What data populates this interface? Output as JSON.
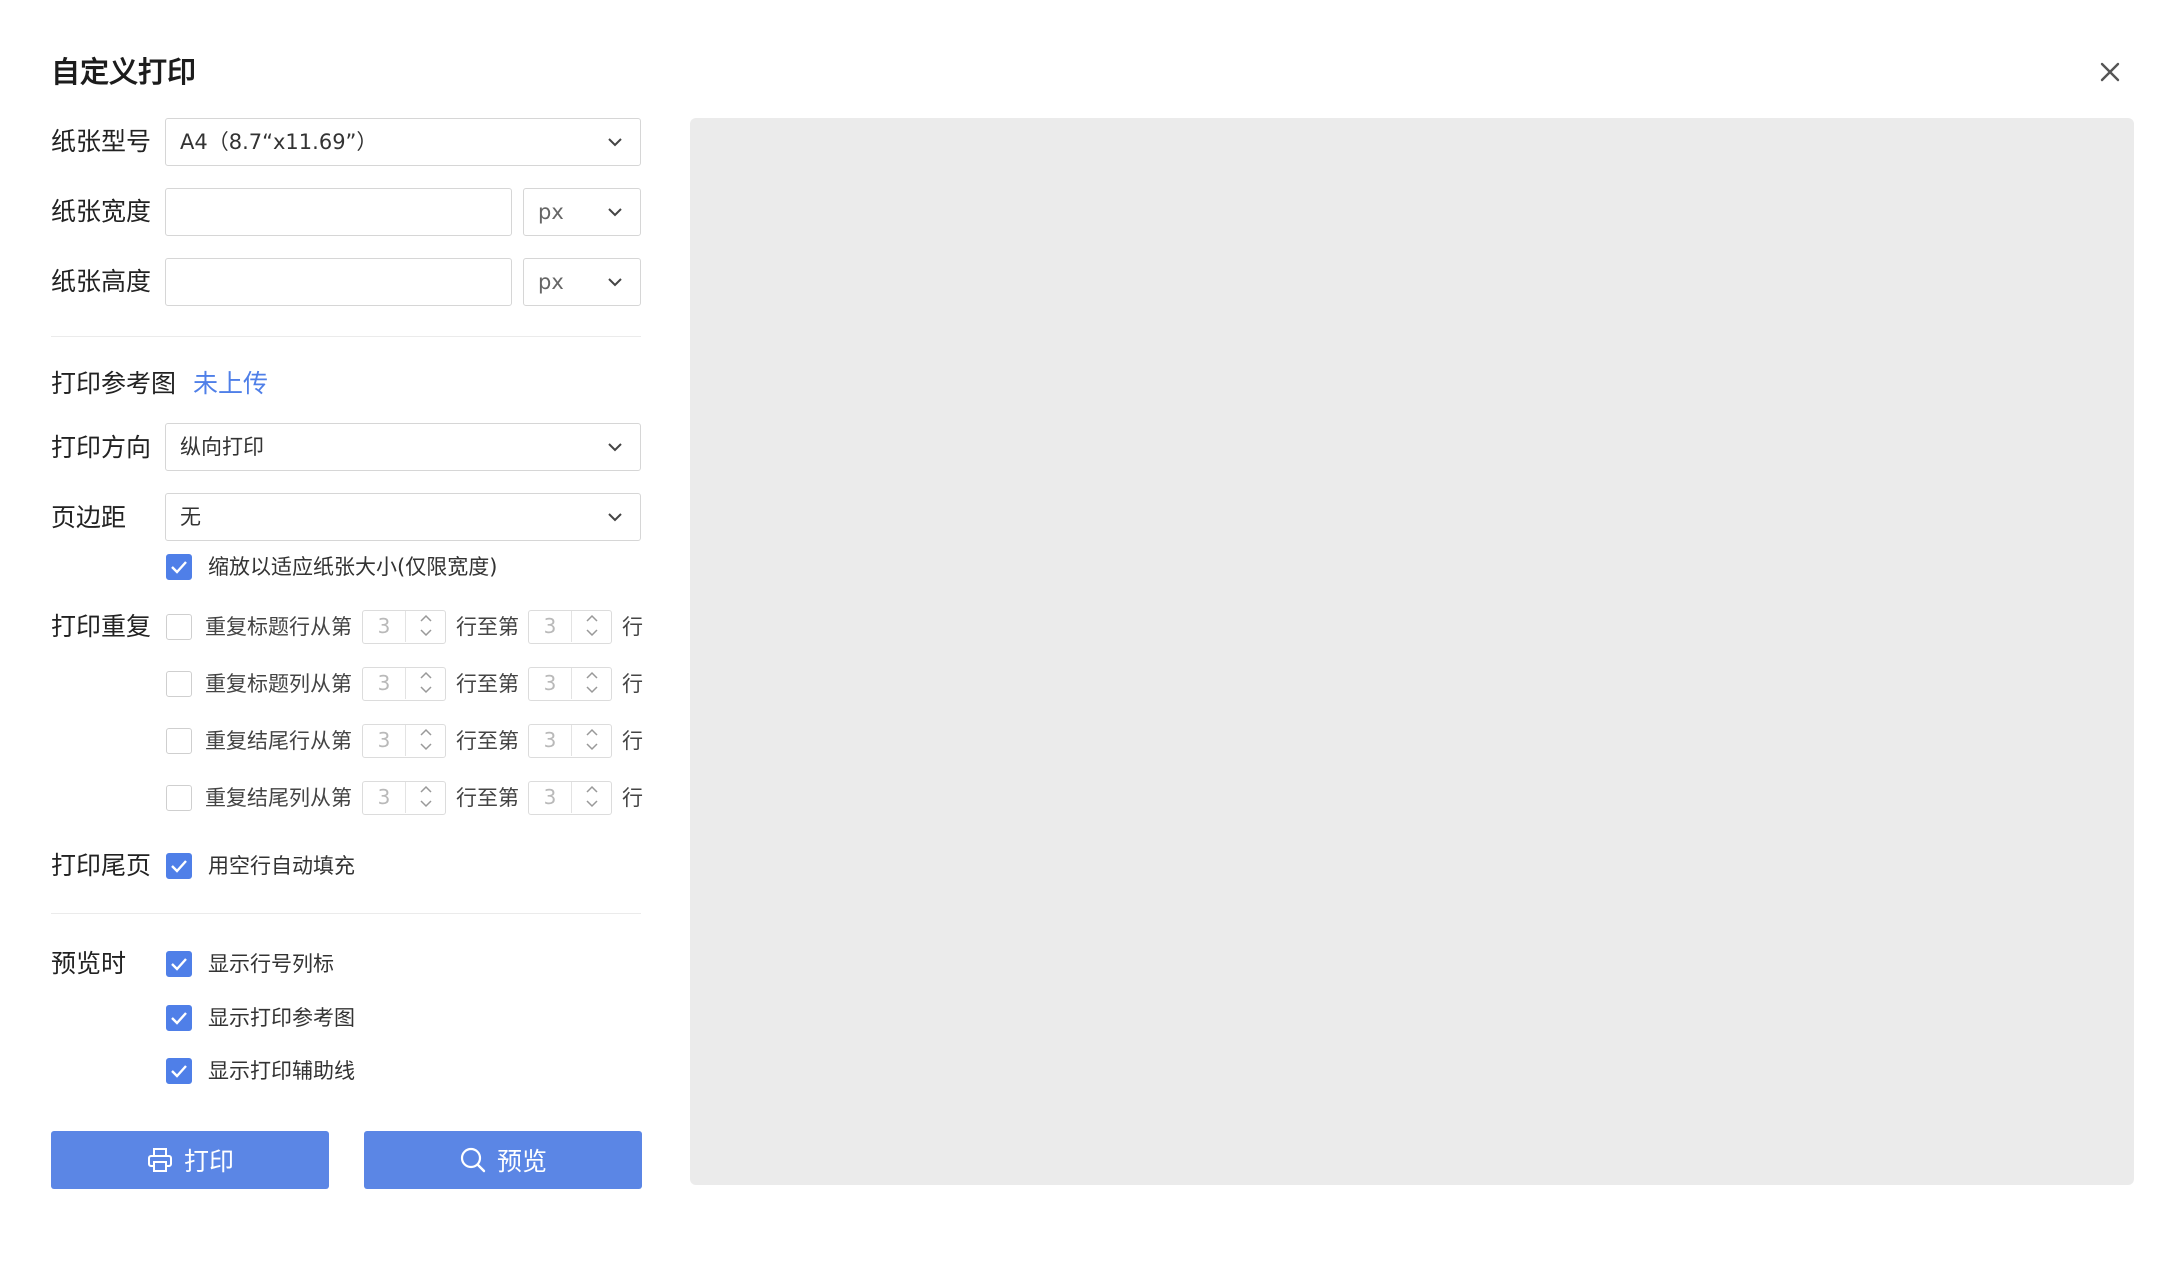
{
  "dialog": {
    "title": "自定义打印",
    "close_icon": "close-icon"
  },
  "paper": {
    "type_label": "纸张型号",
    "type_value": "A4（8.7“x11.69”）",
    "width_label": "纸张宽度",
    "width_value": "",
    "width_unit": "px",
    "height_label": "纸张高度",
    "height_value": "",
    "height_unit": "px"
  },
  "reference": {
    "label": "打印参考图",
    "status": "未上传"
  },
  "orientation": {
    "label": "打印方向",
    "value": "纵向打印"
  },
  "margin": {
    "label": "页边距",
    "value": "无"
  },
  "scale": {
    "label": "缩放以适应纸张大小(仅限宽度)",
    "checked": true
  },
  "repeat": {
    "label": "打印重复",
    "to_text": "行至第",
    "end_text": "行",
    "rows": [
      {
        "label": "重复标题行从第",
        "from": "3",
        "to": "3",
        "checked": false
      },
      {
        "label": "重复标题列从第",
        "from": "3",
        "to": "3",
        "checked": false
      },
      {
        "label": "重复结尾行从第",
        "from": "3",
        "to": "3",
        "checked": false
      },
      {
        "label": "重复结尾列从第",
        "from": "3",
        "to": "3",
        "checked": false
      }
    ]
  },
  "footer": {
    "label": "打印尾页",
    "option": "用空行自动填充",
    "checked": true
  },
  "preview_options": {
    "label": "预览时",
    "options": [
      {
        "label": "显示行号列标",
        "checked": true
      },
      {
        "label": "显示打印参考图",
        "checked": true
      },
      {
        "label": "显示打印辅助线",
        "checked": true
      }
    ]
  },
  "buttons": {
    "print_label": "打印",
    "print_icon": "printer-icon",
    "preview_label": "预览",
    "preview_icon": "search-icon"
  },
  "colors": {
    "accent": "#5b86e5",
    "link": "#4f7fe8",
    "preview_bg": "#ebebeb"
  }
}
